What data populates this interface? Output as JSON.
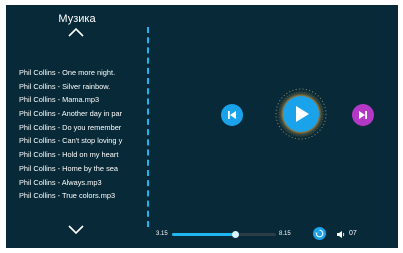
{
  "app": {
    "title": "Музика"
  },
  "playlist": {
    "items": [
      {
        "label": "Phil Collins - One more night."
      },
      {
        "label": "Phil Collins - Silver rainbow."
      },
      {
        "label": "Phil Collins - Mama.mp3"
      },
      {
        "label": "Phil Collins - Another day in par"
      },
      {
        "label": "Phil Collins - Do you remember"
      },
      {
        "label": "Phil Collins - Can't stop loving y"
      },
      {
        "label": "Phil Collins - Hold on my heart"
      },
      {
        "label": "Phil Collins - Home by the sea"
      },
      {
        "label": "Phil Collins - Always.mp3"
      },
      {
        "label": "Phil Collins - True colors.mp3"
      }
    ]
  },
  "player": {
    "current_time": "3.15",
    "total_time": "8.15",
    "progress_fraction": 0.61,
    "volume": "07",
    "icons": {
      "scroll_up": "chevron-up-icon",
      "scroll_down": "chevron-down-icon",
      "previous": "skip-previous-icon",
      "play": "play-icon",
      "next": "skip-next-icon",
      "repeat": "repeat-icon",
      "volume": "speaker-icon"
    }
  },
  "colors": {
    "background": "#082a38",
    "accent": "#1aa2ea",
    "next_button": "#b338c6",
    "glow": "#ffbe50"
  }
}
